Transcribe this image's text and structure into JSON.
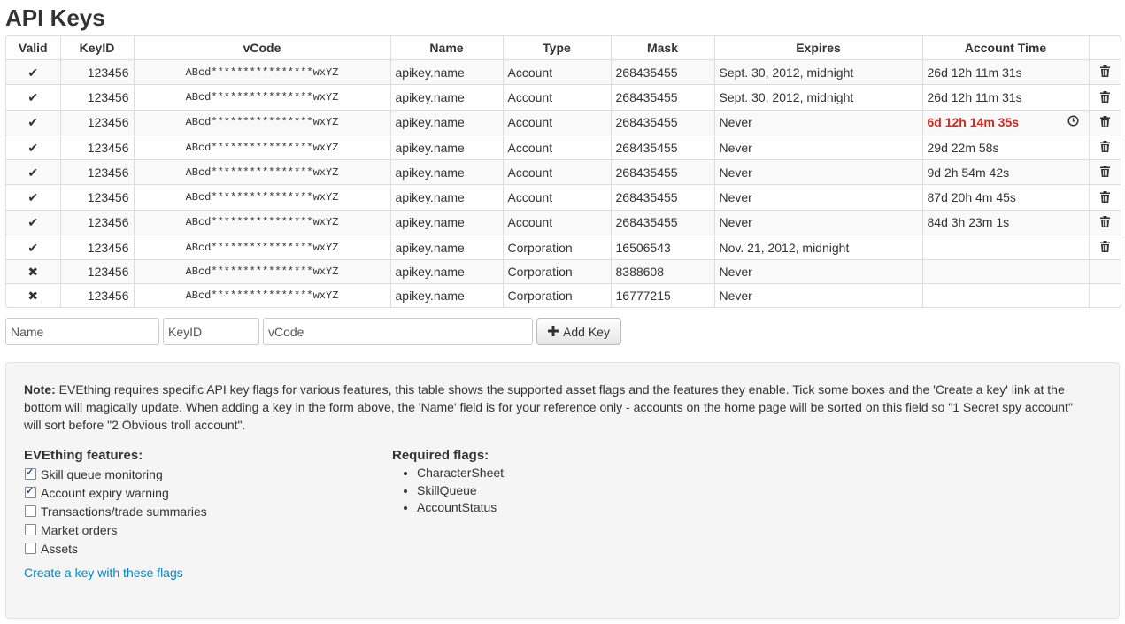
{
  "page_title": "API Keys",
  "columns": [
    "Valid",
    "KeyID",
    "vCode",
    "Name",
    "Type",
    "Mask",
    "Expires",
    "Account Time",
    ""
  ],
  "rows": [
    {
      "valid": "✔",
      "keyid": "123456",
      "vcode": "ABcd****************wxYZ",
      "name": "apikey.name",
      "type": "Account",
      "mask": "268435455",
      "expires": "Sept. 30, 2012, midnight",
      "account_time": "26d 12h 11m 31s",
      "warning": false,
      "deletable": true
    },
    {
      "valid": "✔",
      "keyid": "123456",
      "vcode": "ABcd****************wxYZ",
      "name": "apikey.name",
      "type": "Account",
      "mask": "268435455",
      "expires": "Sept. 30, 2012, midnight",
      "account_time": "26d 12h 11m 31s",
      "warning": false,
      "deletable": true
    },
    {
      "valid": "✔",
      "keyid": "123456",
      "vcode": "ABcd****************wxYZ",
      "name": "apikey.name",
      "type": "Account",
      "mask": "268435455",
      "expires": "Never",
      "account_time": "6d 12h 14m 35s",
      "warning": true,
      "deletable": true
    },
    {
      "valid": "✔",
      "keyid": "123456",
      "vcode": "ABcd****************wxYZ",
      "name": "apikey.name",
      "type": "Account",
      "mask": "268435455",
      "expires": "Never",
      "account_time": "29d 22m 58s",
      "warning": false,
      "deletable": true
    },
    {
      "valid": "✔",
      "keyid": "123456",
      "vcode": "ABcd****************wxYZ",
      "name": "apikey.name",
      "type": "Account",
      "mask": "268435455",
      "expires": "Never",
      "account_time": "9d 2h 54m 42s",
      "warning": false,
      "deletable": true
    },
    {
      "valid": "✔",
      "keyid": "123456",
      "vcode": "ABcd****************wxYZ",
      "name": "apikey.name",
      "type": "Account",
      "mask": "268435455",
      "expires": "Never",
      "account_time": "87d 20h 4m 45s",
      "warning": false,
      "deletable": true
    },
    {
      "valid": "✔",
      "keyid": "123456",
      "vcode": "ABcd****************wxYZ",
      "name": "apikey.name",
      "type": "Account",
      "mask": "268435455",
      "expires": "Never",
      "account_time": "84d 3h 23m 1s",
      "warning": false,
      "deletable": true
    },
    {
      "valid": "✔",
      "keyid": "123456",
      "vcode": "ABcd****************wxYZ",
      "name": "apikey.name",
      "type": "Corporation",
      "mask": "16506543",
      "expires": "Nov. 21, 2012, midnight",
      "account_time": "",
      "warning": false,
      "deletable": true
    },
    {
      "valid": "✖",
      "keyid": "123456",
      "vcode": "ABcd****************wxYZ",
      "name": "apikey.name",
      "type": "Corporation",
      "mask": "8388608",
      "expires": "Never",
      "account_time": "",
      "warning": false,
      "deletable": false
    },
    {
      "valid": "✖",
      "keyid": "123456",
      "vcode": "ABcd****************wxYZ",
      "name": "apikey.name",
      "type": "Corporation",
      "mask": "16777215",
      "expires": "Never",
      "account_time": "",
      "warning": false,
      "deletable": false
    }
  ],
  "form": {
    "name_placeholder": "Name",
    "keyid_placeholder": "KeyID",
    "vcode_placeholder": "vCode",
    "add_label": "Add Key"
  },
  "note": {
    "label": "Note:",
    "text": " EVEthing requires specific API key flags for various features, this table shows the supported asset flags and the features they enable. Tick some boxes and the 'Create a key' link at the bottom will magically update. When adding a key in the form above, the 'Name' field is for your reference only - accounts on the home page will be sorted on this field so \"1 Secret spy account\" will sort before \"2 Obvious troll account\"."
  },
  "features": {
    "title": "EVEthing features:",
    "items": [
      {
        "label": "Skill queue monitoring",
        "checked": true
      },
      {
        "label": "Account expiry warning",
        "checked": true
      },
      {
        "label": "Transactions/trade summaries",
        "checked": false
      },
      {
        "label": "Market orders",
        "checked": false
      },
      {
        "label": "Assets",
        "checked": false
      }
    ]
  },
  "flags": {
    "title": "Required flags:",
    "items": [
      "CharacterSheet",
      "SkillQueue",
      "AccountStatus"
    ]
  },
  "create_link": "Create a key with these flags",
  "colors": {
    "warning": "#d9251d",
    "link": "#0088cc",
    "well": "#f5f5f5"
  },
  "icons": {
    "delete": "trash-icon",
    "timer": "clock-icon",
    "add": "plus-icon",
    "valid": "check-icon",
    "invalid": "cross-icon"
  }
}
